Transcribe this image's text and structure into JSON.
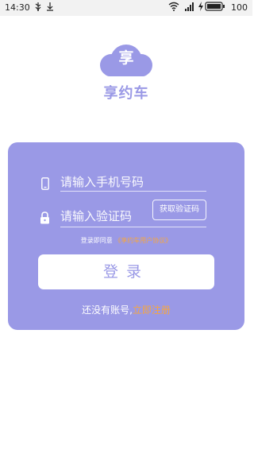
{
  "status_bar": {
    "time": "14:30",
    "battery": "100",
    "icons": [
      "usb-icon",
      "download-icon",
      "wifi-icon",
      "signal-icon",
      "charging-icon",
      "battery-icon"
    ]
  },
  "logo": {
    "char": "享",
    "app_name": "享约车",
    "icon": "cloud-icon",
    "color": "#9a99e6"
  },
  "login_form": {
    "phone": {
      "placeholder": "请输入手机号码",
      "value": "",
      "icon": "phone-icon"
    },
    "code": {
      "placeholder": "请输入验证码",
      "value": "",
      "icon": "lock-icon"
    },
    "get_code_label": "获取验证码",
    "agree_prefix": "登录即同意",
    "agree_link": "《享约车用户协议》",
    "login_label": "登录",
    "register_prefix": "还没有账号,",
    "register_link": "立即注册"
  },
  "colors": {
    "accent": "#9a99e6",
    "link": "#f6a640",
    "background": "#ffffff"
  }
}
